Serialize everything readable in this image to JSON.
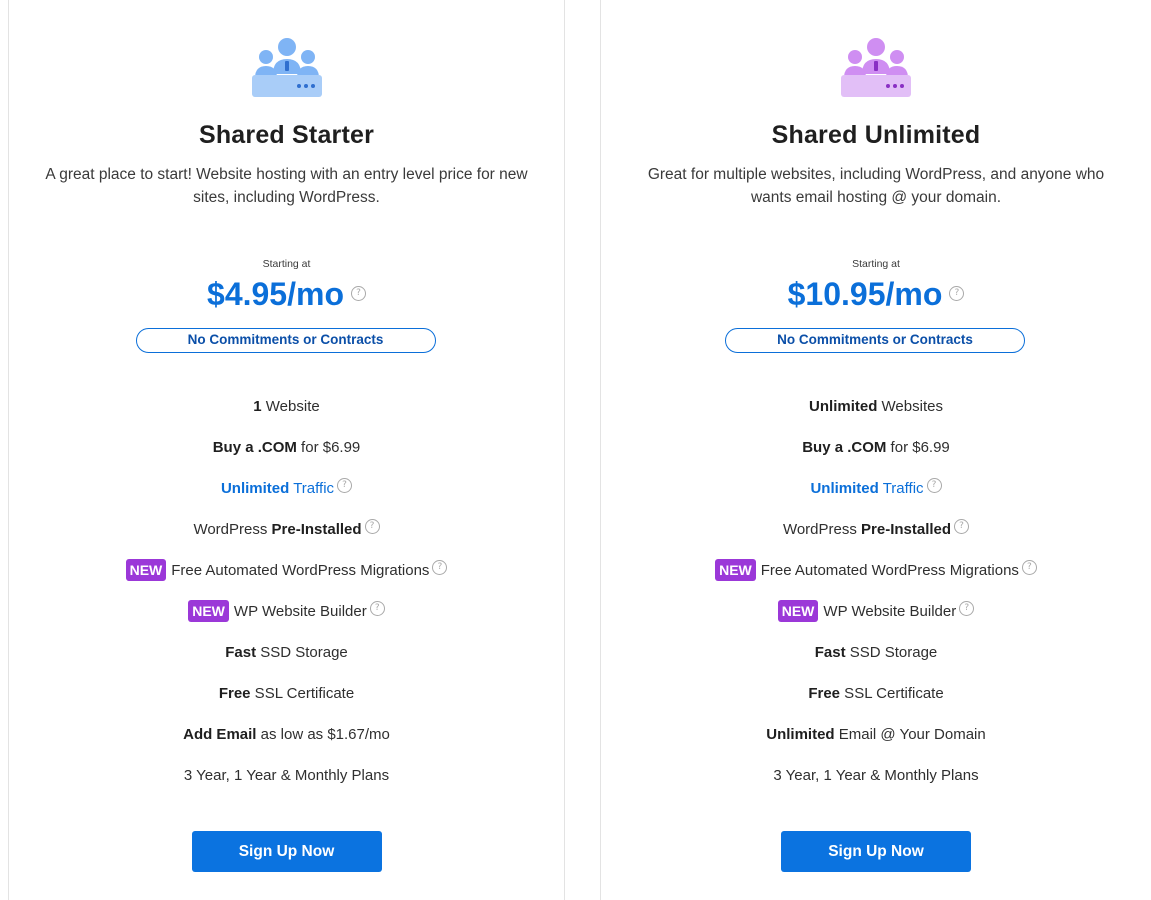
{
  "colors": {
    "accent_blue": "#0b6fd9",
    "button_blue": "#0b73e0",
    "badge_purple": "#9b38d8",
    "starter_icon": "#7fb4f5",
    "unlimited_icon": "#cf8ef2"
  },
  "plans": [
    {
      "icon": "users-server-icon",
      "title": "Shared Starter",
      "description": "A great place to start! Website hosting with an entry level price for new sites, including WordPress.",
      "starting_label": "Starting at",
      "price": "$4.95/mo",
      "help_glyph": "?",
      "pill": "No Commitments or Contracts",
      "features": [
        {
          "bold": "1",
          "text": " Website"
        },
        {
          "bold": "Buy a .COM",
          "text": " for $6.99"
        },
        {
          "bold": "Unlimited",
          "text": " Traffic"
        },
        {
          "prefix": "WordPress ",
          "bold": "Pre-Installed"
        },
        {
          "badge": "NEW",
          "text": "Free Automated WordPress Migrations"
        },
        {
          "badge": "NEW",
          "text": "WP Website Builder"
        },
        {
          "bold": "Fast",
          "text": " SSD Storage"
        },
        {
          "bold": "Free",
          "text": " SSL Certificate"
        },
        {
          "bold": "Add Email",
          "text": " as low as $1.67/mo"
        },
        {
          "text": "3 Year, 1 Year & Monthly Plans"
        }
      ],
      "cta": "Sign Up Now"
    },
    {
      "icon": "users-server-icon",
      "title": "Shared Unlimited",
      "description": "Great for multiple websites, including WordPress, and anyone who wants email hosting @ your domain.",
      "starting_label": "Starting at",
      "price": "$10.95/mo",
      "help_glyph": "?",
      "pill": "No Commitments or Contracts",
      "features": [
        {
          "bold": "Unlimited",
          "text": " Websites"
        },
        {
          "bold": "Buy a .COM",
          "text": " for $6.99"
        },
        {
          "bold": "Unlimited",
          "text": " Traffic"
        },
        {
          "prefix": "WordPress ",
          "bold": "Pre-Installed"
        },
        {
          "badge": "NEW",
          "text": "Free Automated WordPress Migrations"
        },
        {
          "badge": "NEW",
          "text": "WP Website Builder"
        },
        {
          "bold": "Fast",
          "text": " SSD Storage"
        },
        {
          "bold": "Free",
          "text": " SSL Certificate"
        },
        {
          "bold": "Unlimited",
          "text": " Email @ Your Domain"
        },
        {
          "text": "3 Year, 1 Year & Monthly Plans"
        }
      ],
      "cta": "Sign Up Now"
    }
  ]
}
